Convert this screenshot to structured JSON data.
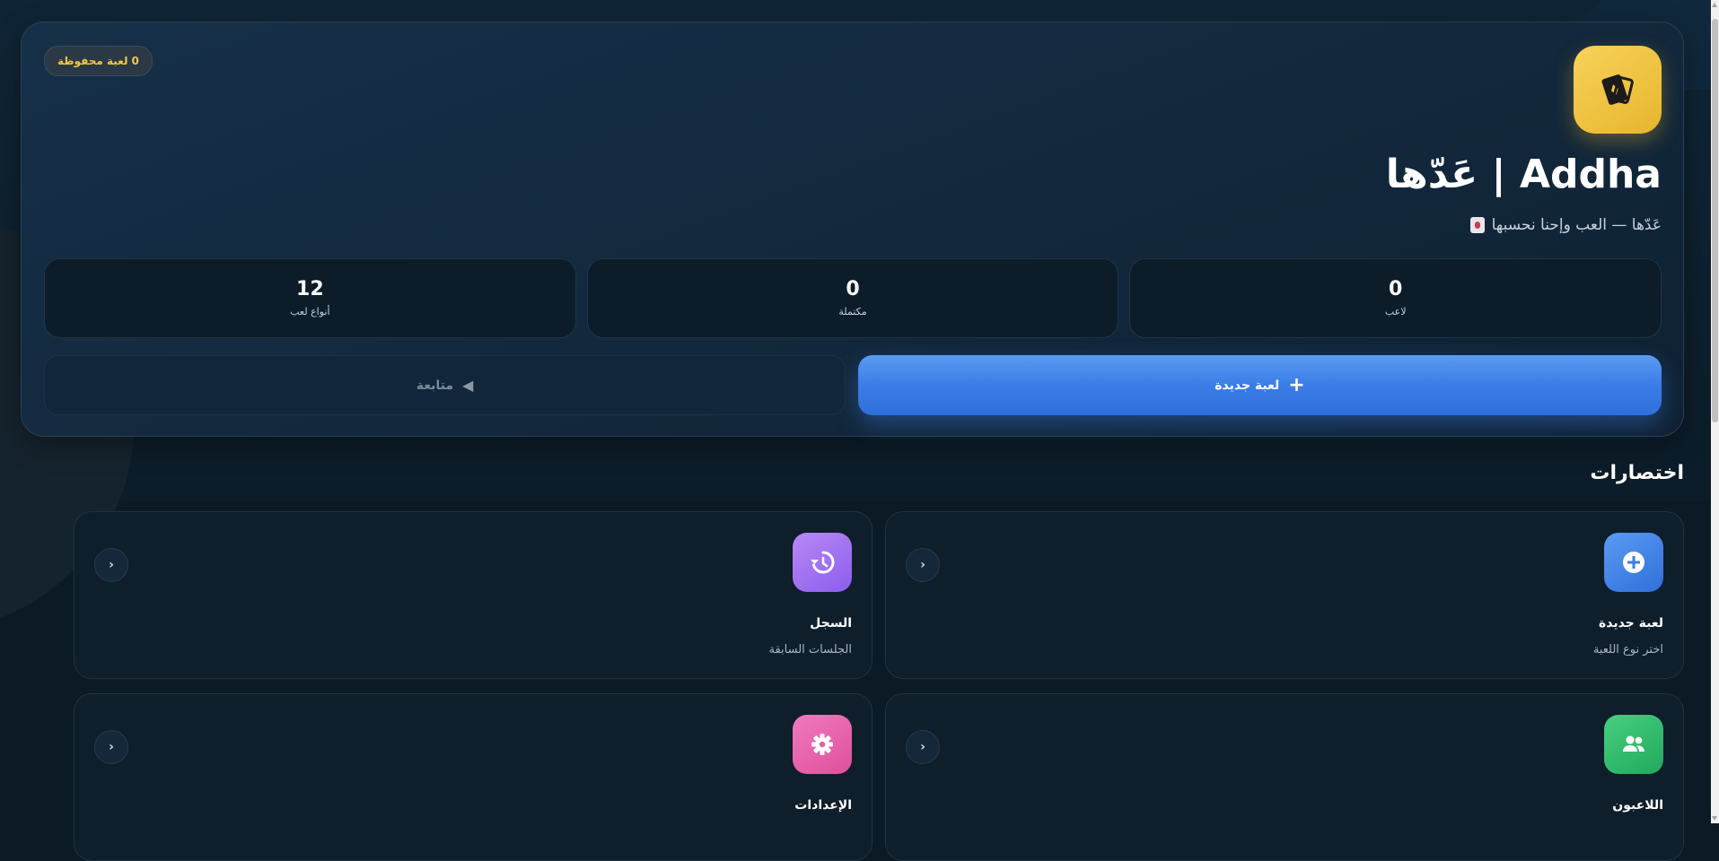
{
  "header": {
    "saved_count": "0",
    "saved_label": "لعبة محفوظة",
    "title": "Addha | عَدّها",
    "tagline": "عَدّها — العب وإحنا نحسبها",
    "logo_icon": "playing-cards-icon"
  },
  "stats": [
    {
      "value": "0",
      "label": "لاعب"
    },
    {
      "value": "0",
      "label": "مكتملة"
    },
    {
      "value": "12",
      "label": "أنواع لعب"
    }
  ],
  "actions": {
    "new_game_label": "لعبة جديدة",
    "continue_label": "متابعة"
  },
  "shortcuts_section": {
    "title": "اختصارات",
    "items": [
      {
        "title": "لعبة جديدة",
        "subtitle": "اختر نوع اللعبة",
        "icon": "plus-circle-icon",
        "color": "#3b7de6"
      },
      {
        "title": "السجل",
        "subtitle": "الجلسات السابقة",
        "icon": "history-icon",
        "color": "#9b6ef0"
      },
      {
        "title": "اللاعبون",
        "subtitle": "",
        "icon": "users-icon",
        "color": "#2fbf6e"
      },
      {
        "title": "الإعدادات",
        "subtitle": "",
        "icon": "gear-icon",
        "color": "#e85ea9"
      }
    ]
  },
  "colors": {
    "accent_blue": "#3b7de6",
    "accent_gold": "#f2c744",
    "background": "#0b1a24"
  }
}
